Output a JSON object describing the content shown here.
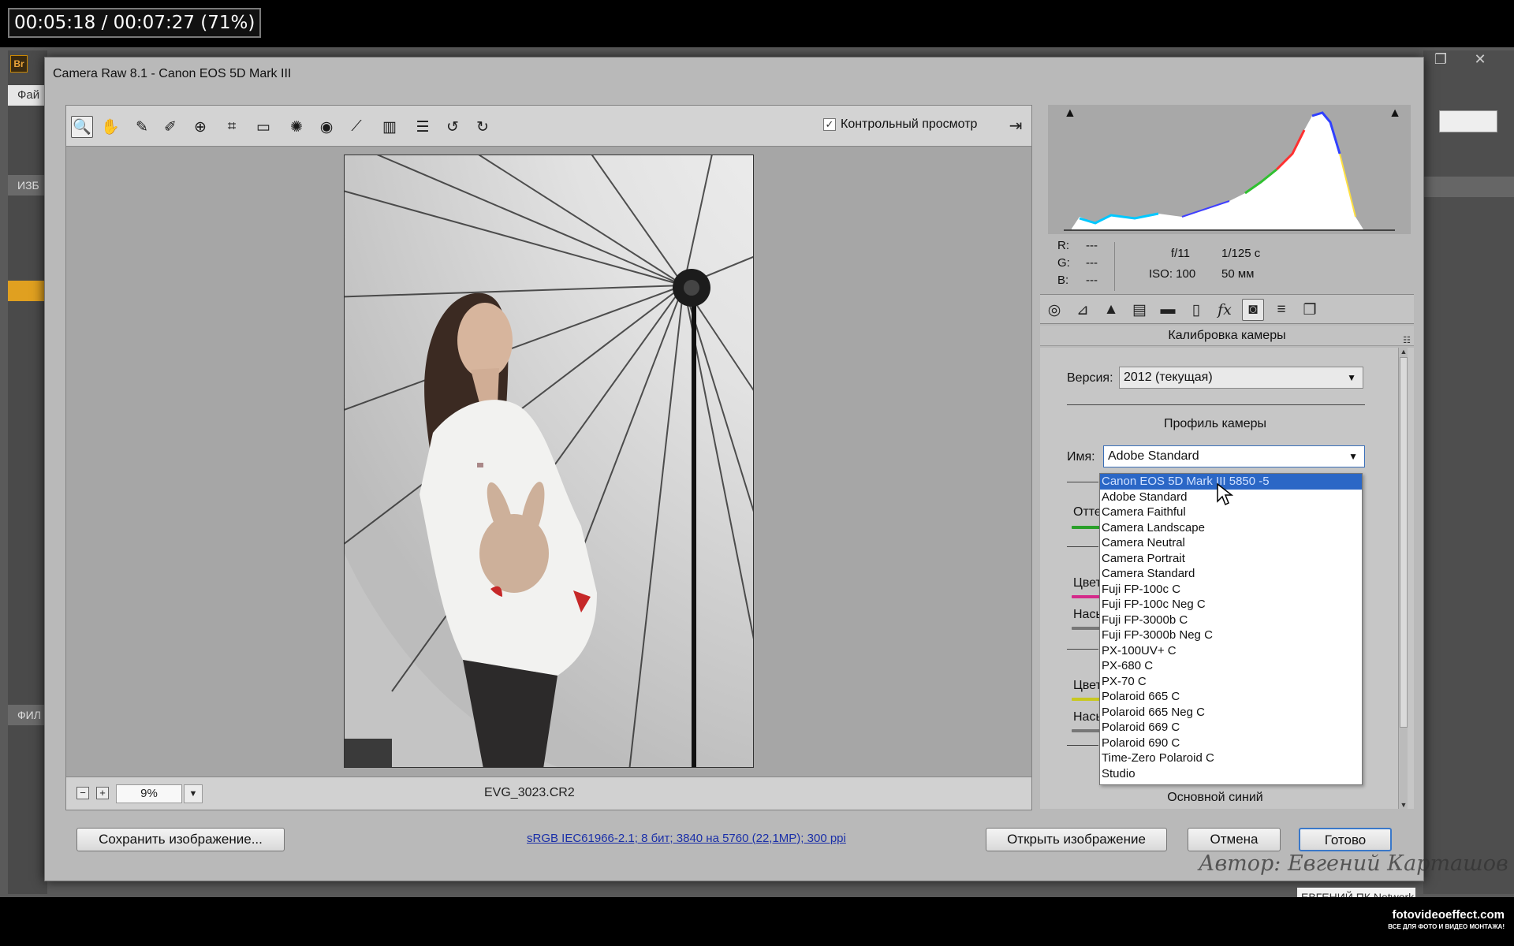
{
  "overlay": {
    "timer": "00:05:18 / 00:07:27 (71%)"
  },
  "background_app": {
    "logo": "Br",
    "menu_fragment": "Фай",
    "left_panel_header": "ИЗБ",
    "left_panel_header2": "ФИЛ",
    "window_controls": [
      "❐",
      "✕"
    ]
  },
  "dialog": {
    "title": "Camera Raw 8.1  -  Canon EOS 5D Mark III"
  },
  "toolbar": {
    "tools": [
      {
        "name": "zoom-tool",
        "glyph": "🔍"
      },
      {
        "name": "hand-tool",
        "glyph": "✋"
      },
      {
        "name": "white-balance-tool",
        "glyph": "✎"
      },
      {
        "name": "color-sampler-tool",
        "glyph": "✐"
      },
      {
        "name": "targeted-adjustment-tool",
        "glyph": "⊕"
      },
      {
        "name": "crop-tool",
        "glyph": "⌗"
      },
      {
        "name": "straighten-tool",
        "glyph": "▭"
      },
      {
        "name": "spot-removal-tool",
        "glyph": "✺"
      },
      {
        "name": "red-eye-tool",
        "glyph": "◉"
      },
      {
        "name": "adjustment-brush-tool",
        "glyph": "⟋"
      },
      {
        "name": "graduated-filter-tool",
        "glyph": "▥"
      },
      {
        "name": "preferences-tool",
        "glyph": "☰"
      },
      {
        "name": "rotate-ccw-tool",
        "glyph": "↺"
      },
      {
        "name": "rotate-cw-tool",
        "glyph": "↻"
      }
    ],
    "preview_label": "Контрольный просмотр",
    "preview_checked": "✓",
    "fullscreen_glyph": "⇥"
  },
  "status": {
    "zoom_out": "−",
    "zoom_in": "+",
    "zoom_value": "9%",
    "zoom_arrow": "▼",
    "filename": "EVG_3023.CR2"
  },
  "histogram": {
    "r_label": "R:",
    "r_value": "---",
    "g_label": "G:",
    "g_value": "---",
    "b_label": "B:",
    "b_value": "---",
    "aperture": "f/11",
    "shutter": "1/125 с",
    "iso": "ISO: 100",
    "focal": "50 мм",
    "clip_left": "▲",
    "clip_right": "▲"
  },
  "panel_tabs": [
    {
      "name": "tab-basic-icon",
      "glyph": "◎"
    },
    {
      "name": "tab-tone-curve-icon",
      "glyph": "⊿"
    },
    {
      "name": "tab-detail-icon",
      "glyph": "▲"
    },
    {
      "name": "tab-hsl-icon",
      "glyph": "▤"
    },
    {
      "name": "tab-split-toning-icon",
      "glyph": "▬"
    },
    {
      "name": "tab-lens-icon",
      "glyph": "▯"
    },
    {
      "name": "tab-effects-icon",
      "glyph": "fx"
    },
    {
      "name": "tab-camera-calibration-icon",
      "glyph": "◙"
    },
    {
      "name": "tab-presets-icon",
      "glyph": "≡"
    },
    {
      "name": "tab-snapshots-icon",
      "glyph": "❐"
    }
  ],
  "calibration": {
    "title": "Калибровка камеры",
    "menu_glyph": "☷",
    "version_label": "Версия:",
    "version_value": "2012 (текущая)",
    "profile_section": "Профиль камеры",
    "name_label": "Имя:",
    "name_value": "Adobe Standard",
    "dropdown_arrow": "▼",
    "partial_labels": [
      "Отте",
      "Цвет",
      "Насы",
      "Цвет",
      "Насы"
    ],
    "bottom_section": "Основной синий",
    "scroll_up": "▲",
    "scroll_down": "▼"
  },
  "profile_options": [
    "Canon EOS 5D Mark III 5850 -5",
    "Adobe Standard",
    "Camera Faithful",
    "Camera Landscape",
    "Camera Neutral",
    "Camera Portrait",
    "Camera Standard",
    "Fuji FP-100c C",
    "Fuji FP-100c Neg C",
    "Fuji FP-3000b C",
    "Fuji FP-3000b Neg C",
    "PX-100UV+ C",
    "PX-680 C",
    "PX-70 C",
    "Polaroid 665 C",
    "Polaroid 665 Neg C",
    "Polaroid 669 C",
    "Polaroid 690 C",
    "Time-Zero Polaroid C",
    "Studio"
  ],
  "footer": {
    "save_label": "Сохранить изображение...",
    "workflow_link": "sRGB IEC61966-2.1; 8 бит; 3840 на 5760 (22,1МР); 300 ppi",
    "open_label": "Открыть изображение",
    "cancel_label": "Отмена",
    "done_label": "Готово"
  },
  "watermark": {
    "author": "Автор: Евгений Карташов",
    "tooltip_fragment": "ЕВГЕНИЙ ПК Network"
  },
  "branding": {
    "site": "fotovideoeffect.com",
    "tagline": "ВСЕ ДЛЯ ФОТО И ВИДЕО МОНТАЖА!"
  }
}
